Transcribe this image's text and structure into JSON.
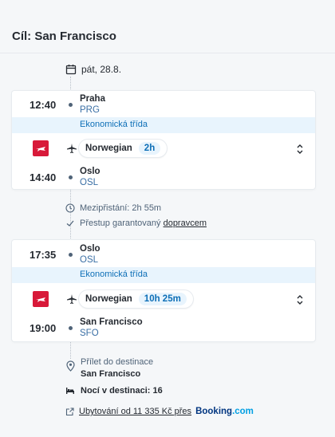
{
  "header": {
    "title": "Cíl: San Francisco"
  },
  "date": "pát, 28.8.",
  "segments": [
    {
      "dep_time": "12:40",
      "dep_city": "Praha",
      "dep_code": "PRG",
      "cabin": "Ekonomická třída",
      "carrier": "Norwegian",
      "duration": "2h",
      "arr_time": "14:40",
      "arr_city": "Oslo",
      "arr_code": "OSL"
    },
    {
      "dep_time": "17:35",
      "dep_city": "Oslo",
      "dep_code": "OSL",
      "cabin": "Ekonomická třída",
      "carrier": "Norwegian",
      "duration": "10h 25m",
      "arr_time": "19:00",
      "arr_city": "San Francisco",
      "arr_code": "SFO"
    }
  ],
  "layover": {
    "text": "Mezipřistání: 2h 55m",
    "guarantee_prefix": "Přestup garantovaný",
    "guarantee_link": "dopravcem"
  },
  "arrival": {
    "label": "Přílet do destinace",
    "city": "San Francisco"
  },
  "nights": "Nocí v destinaci: 16",
  "hotel": {
    "link": "Ubytování od 11 335 Kč přes",
    "brand": "Booking",
    "brand_suffix": ".com"
  },
  "icons": [
    "calendar-icon",
    "airplane-icon",
    "chevron-updown-icon",
    "clock-icon",
    "check-icon",
    "location-pin-icon",
    "bed-icon",
    "external-link-icon",
    "norwegian-logo-icon"
  ],
  "colors": {
    "accent": "#0e6fb7",
    "cabin_bg": "#e8f4fd",
    "norwegian_red": "#d81939",
    "booking_blue": "#003580"
  }
}
